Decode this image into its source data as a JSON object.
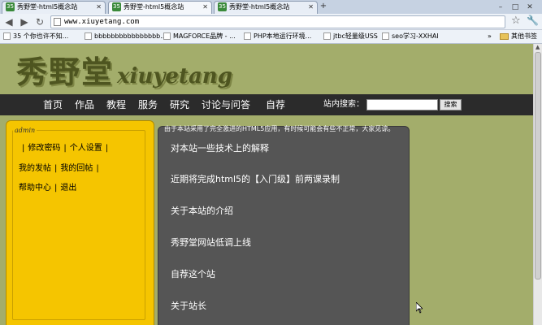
{
  "browser": {
    "tabs": [
      {
        "title": "秀野堂-html5概念站",
        "active": false
      },
      {
        "title": "秀野堂-html5概念站",
        "active": true
      },
      {
        "title": "秀野堂-html5概念站",
        "active": false
      }
    ],
    "new_tab_label": "+",
    "address": "www.xiuyetang.com",
    "bookmarks": [
      "35 个你也许不知...",
      "bbbbbbbbbbbbbbbb...",
      "MAGFORCE品牌 - ...",
      "PHP本地运行环境...",
      "jtbc轻量级USS",
      "seo学习-XXHAI"
    ],
    "other_bookmarks": "其他书签"
  },
  "site": {
    "logo_cn": "秀野堂",
    "logo_en": "xiuyetang",
    "nav": [
      "首页",
      "作品",
      "教程",
      "服务",
      "研究",
      "讨论与问答",
      "自荐"
    ],
    "search_label": "站内搜索：",
    "search_button": "搜索"
  },
  "sidebar": {
    "legend": "admin",
    "row1": [
      "修改密码",
      "个人设置"
    ],
    "row2": [
      "我的发帖",
      "我的回帖"
    ],
    "row3": [
      "帮助中心",
      "退出"
    ]
  },
  "main": {
    "notice": "由于本站采用了完全激进的HTML5应用，有时候可能会有些不正常，大家见谅。",
    "links": [
      "对本站一些技术上的解释",
      "近期将完成html5的【入门级】前两课录制",
      "关于本站的介绍",
      "秀野堂网站低调上线",
      "自荐这个站",
      "关于站长"
    ]
  },
  "colors": {
    "page_bg": "#a3ad6b",
    "nav_bg": "#2b2b2b",
    "sidebar_bg": "#f5c500",
    "main_bg": "#555555"
  }
}
